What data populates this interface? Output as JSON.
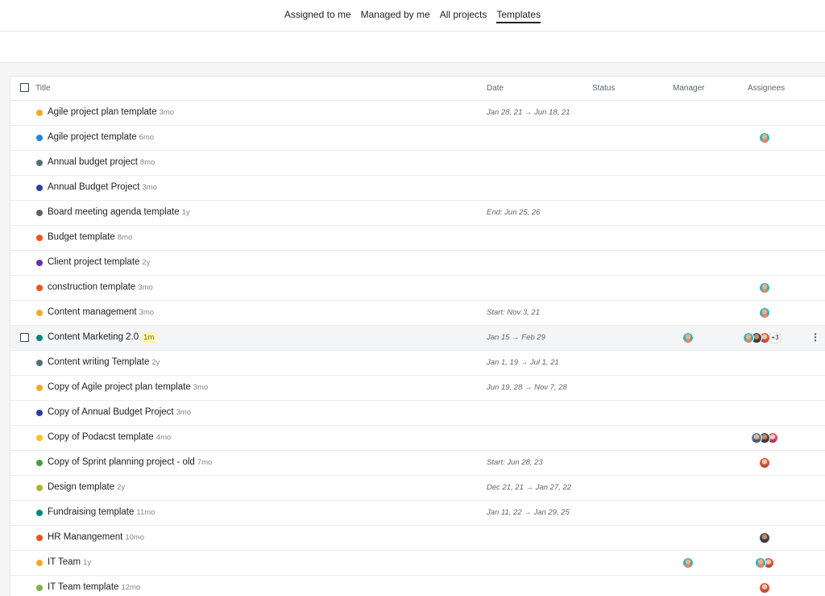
{
  "nav": {
    "tabs": [
      {
        "label": "Assigned to me",
        "active": false
      },
      {
        "label": "Managed by me",
        "active": false
      },
      {
        "label": "All projects",
        "active": false
      },
      {
        "label": "Templates",
        "active": true
      }
    ]
  },
  "table": {
    "columns": {
      "title": "Title",
      "date": "Date",
      "status": "Status",
      "manager": "Manager",
      "assignees": "Assignees"
    },
    "rows": [
      {
        "title": "Agile project plan template",
        "age": "3mo",
        "color": "#f9a825",
        "date": "Jan 28, 21 → Jun 18, 21",
        "manager": [],
        "assignees": []
      },
      {
        "title": "Agile project template",
        "age": "6mo",
        "color": "#1e88e5",
        "date": "",
        "manager": [],
        "assignees": [
          "teal"
        ]
      },
      {
        "title": "Annual budget project",
        "age": "8mo",
        "color": "#546e7a",
        "date": "",
        "manager": [],
        "assignees": []
      },
      {
        "title": "Annual Budget Project",
        "age": "3mo",
        "color": "#303f9f",
        "date": "",
        "manager": [],
        "assignees": []
      },
      {
        "title": "Board meeting agenda template",
        "age": "1y",
        "color": "#616161",
        "date": "End: Jun 25, 26",
        "manager": [],
        "assignees": []
      },
      {
        "title": "Budget template",
        "age": "8mo",
        "color": "#f4511e",
        "date": "",
        "manager": [],
        "assignees": []
      },
      {
        "title": "Client project template",
        "age": "2y",
        "color": "#5e35b1",
        "date": "",
        "manager": [],
        "assignees": []
      },
      {
        "title": "construction template",
        "age": "3mo",
        "color": "#f4511e",
        "date": "",
        "manager": [],
        "assignees": [
          "teal"
        ]
      },
      {
        "title": "Content management",
        "age": "3mo",
        "color": "#f9a825",
        "date": "Start: Nov 3, 21",
        "manager": [],
        "assignees": [
          "teal"
        ]
      },
      {
        "title": "Content Marketing 2.0",
        "age": "1m",
        "color": "#00897b",
        "date": "Jan 15 → Feb 29",
        "manager": [
          "teal"
        ],
        "assignees": [
          "teal",
          "dark",
          "red"
        ],
        "more": "+3",
        "hover": true
      },
      {
        "title": "Content writing Template",
        "age": "2y",
        "color": "#546e7a",
        "date": "Jan 1, 19 → Jul 1, 21",
        "manager": [],
        "assignees": []
      },
      {
        "title": "Copy of Agile project plan template",
        "age": "3mo",
        "color": "#f9a825",
        "date": "Jun 19, 28 → Nov 7, 28",
        "manager": [],
        "assignees": []
      },
      {
        "title": "Copy of Annual Budget Project",
        "age": "3mo",
        "color": "#303f9f",
        "date": "",
        "manager": [],
        "assignees": []
      },
      {
        "title": "Copy of Podacst template",
        "age": "4mo",
        "color": "#fbc02d",
        "date": "",
        "manager": [],
        "assignees": [
          "blue",
          "dark",
          "pink"
        ]
      },
      {
        "title": "Copy of Sprint planning project - old",
        "age": "7mo",
        "color": "#43a047",
        "date": "Start: Jun 28, 23",
        "manager": [],
        "assignees": [
          "red"
        ]
      },
      {
        "title": "Design template",
        "age": "2y",
        "color": "#afb42b",
        "date": "Dec 21, 21 → Jan 27, 22",
        "manager": [],
        "assignees": []
      },
      {
        "title": "Fundraising template",
        "age": "11mo",
        "color": "#00897b",
        "date": "Jan 11, 22 → Jan 29, 25",
        "manager": [],
        "assignees": []
      },
      {
        "title": "HR Manangement",
        "age": "10mo",
        "color": "#f4511e",
        "date": "",
        "manager": [],
        "assignees": [
          "dark"
        ]
      },
      {
        "title": "IT Team",
        "age": "1y",
        "color": "#f9a825",
        "date": "",
        "manager": [
          "teal"
        ],
        "assignees": [
          "teal",
          "red"
        ]
      },
      {
        "title": "IT Team template",
        "age": "12mo",
        "color": "#7cb342",
        "date": "",
        "manager": [],
        "assignees": [
          "red"
        ]
      }
    ]
  }
}
